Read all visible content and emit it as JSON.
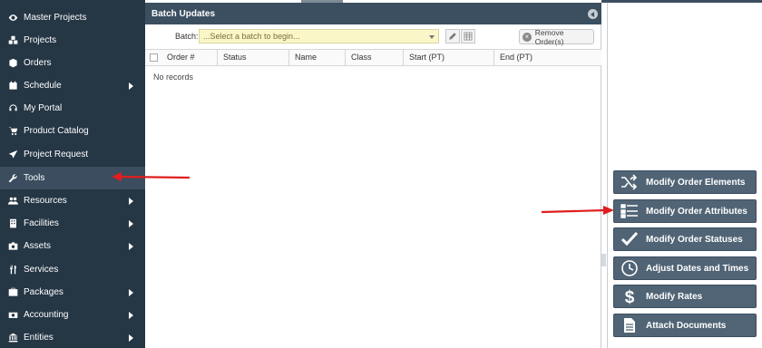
{
  "sidebar": {
    "items": [
      {
        "label": "Master Projects",
        "icon": "eye-icon",
        "submenu": false
      },
      {
        "label": "Projects",
        "icon": "cubes-icon",
        "submenu": false
      },
      {
        "label": "Orders",
        "icon": "cube-icon",
        "submenu": false
      },
      {
        "label": "Schedule",
        "icon": "calendar-icon",
        "submenu": true
      },
      {
        "label": "My Portal",
        "icon": "headset-icon",
        "submenu": false
      },
      {
        "label": "Product Catalog",
        "icon": "cart-icon",
        "submenu": false
      },
      {
        "label": "Project Request",
        "icon": "paper-plane-icon",
        "submenu": false
      },
      {
        "label": "Tools",
        "icon": "wrench-icon",
        "submenu": false,
        "active": true
      },
      {
        "label": "Resources",
        "icon": "users-icon",
        "submenu": true
      },
      {
        "label": "Facilities",
        "icon": "building-icon",
        "submenu": true
      },
      {
        "label": "Assets",
        "icon": "camera-icon",
        "submenu": true
      },
      {
        "label": "Services",
        "icon": "utensils-icon",
        "submenu": false
      },
      {
        "label": "Packages",
        "icon": "briefcase-icon",
        "submenu": true
      },
      {
        "label": "Accounting",
        "icon": "money-icon",
        "submenu": true
      },
      {
        "label": "Entities",
        "icon": "bank-icon",
        "submenu": true
      }
    ]
  },
  "panel": {
    "title": "Batch Updates",
    "batch_label": "Batch:",
    "batch_placeholder": "...Select a batch to begin...",
    "remove_label": "Remove Order(s)",
    "columns": [
      "Order #",
      "Status",
      "Name",
      "Class",
      "Start (PT)",
      "End (PT)"
    ],
    "empty_text": "No records"
  },
  "actions": [
    {
      "label": "Modify Order Elements",
      "icon": "shuffle-icon"
    },
    {
      "label": "Modify Order Attributes",
      "icon": "list-icon"
    },
    {
      "label": "Modify Order Statuses",
      "icon": "checkmark-icon"
    },
    {
      "label": "Adjust Dates and Times",
      "icon": "clock-icon"
    },
    {
      "label": "Modify Rates",
      "icon": "dollar-icon"
    },
    {
      "label": "Attach Documents",
      "icon": "document-icon"
    }
  ],
  "colors": {
    "sidebar_bg": "#253645",
    "header_bg": "#3c4f61",
    "action_bg": "#506475",
    "annotation_arrow": "#e01e1e",
    "batch_select_bg": "#fbf6c7"
  }
}
